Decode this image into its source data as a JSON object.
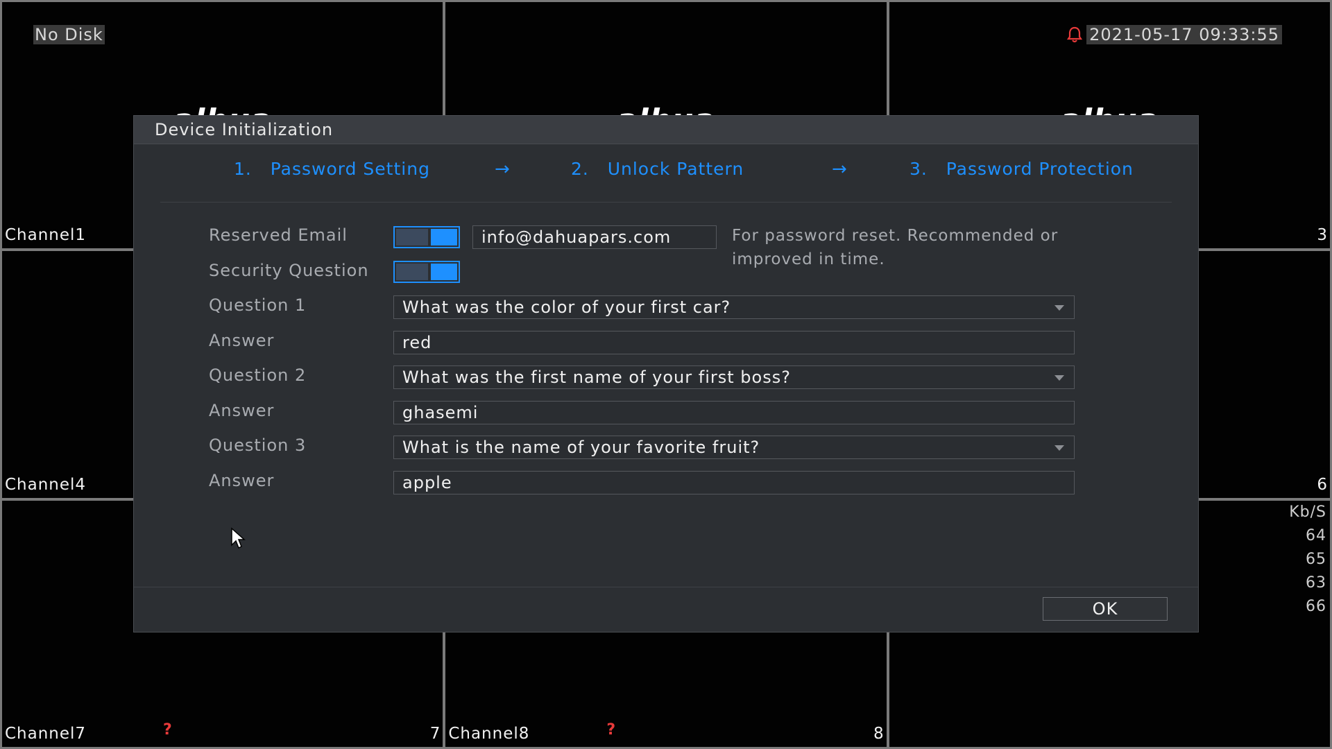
{
  "overlay": {
    "disk_status": "No Disk",
    "datetime": "2021-05-17 09:33:55",
    "brand": "alhua",
    "bitrate_unit": "Kb/S",
    "bitrates": [
      "64",
      "65",
      "63",
      "66"
    ]
  },
  "channels": {
    "c1": {
      "label": "Channel1"
    },
    "c3": {
      "num": "3"
    },
    "c4": {
      "label": "Channel4"
    },
    "c6": {
      "num": "6"
    },
    "c7": {
      "label": "Channel7",
      "num": "7",
      "flag": "?"
    },
    "c8": {
      "label": "Channel8",
      "num": "8",
      "flag": "?"
    }
  },
  "dialog": {
    "title": "Device Initialization",
    "steps": [
      {
        "num": "1.",
        "label": "Password Setting"
      },
      {
        "num": "2.",
        "label": "Unlock Pattern"
      },
      {
        "num": "3.",
        "label": "Password Protection"
      }
    ],
    "arrow": "→",
    "reserved_email_label": "Reserved Email",
    "reserved_email_enabled": true,
    "reserved_email_value": "info@dahuapars.com",
    "hint": "For password reset. Recommended or improved in time.",
    "security_question_label": "Security Question",
    "security_question_enabled": true,
    "questions": [
      {
        "label": "Question 1",
        "value": "What was the color of your first car?",
        "answer_label": "Answer",
        "answer": "red"
      },
      {
        "label": "Question 2",
        "value": "What was the first name of your first boss?",
        "answer_label": "Answer",
        "answer": "ghasemi"
      },
      {
        "label": "Question 3",
        "value": "What is the name of your favorite fruit?",
        "answer_label": "Answer",
        "answer": "apple"
      }
    ],
    "ok_label": "OK"
  },
  "colors": {
    "accent": "#1e90ff",
    "alarm": "#e83a3a",
    "dialog_bg": "#2c2f33"
  },
  "icons": {
    "alarm": "bell-icon",
    "dropdown": "chevron-down-icon",
    "pointer": "mouse-cursor-icon"
  }
}
